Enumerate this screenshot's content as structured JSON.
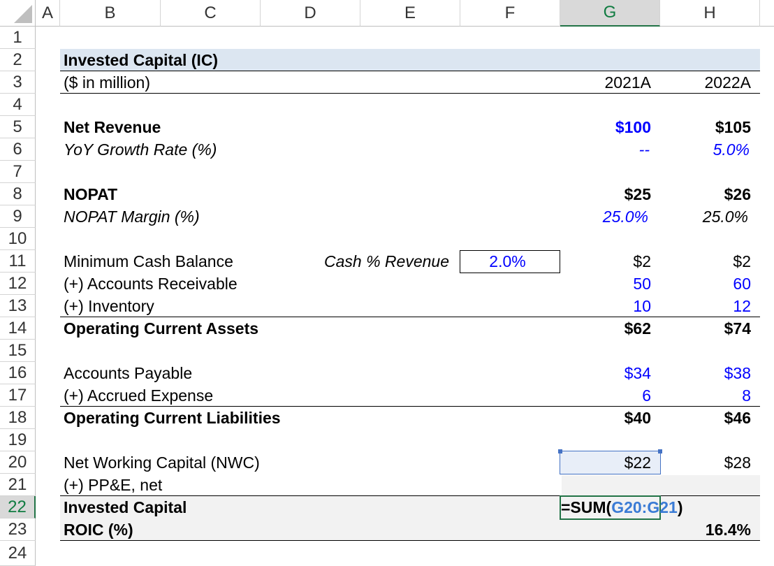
{
  "columns": [
    "A",
    "B",
    "C",
    "D",
    "E",
    "F",
    "G",
    "H"
  ],
  "rows": [
    "1",
    "2",
    "3",
    "4",
    "5",
    "6",
    "7",
    "8",
    "9",
    "10",
    "11",
    "12",
    "13",
    "14",
    "15",
    "16",
    "17",
    "18",
    "19",
    "20",
    "21",
    "22",
    "23",
    "24"
  ],
  "table": {
    "title": "Invested Capital (IC)",
    "units": "($ in million)",
    "years": [
      "2021A",
      "2022A"
    ],
    "net_revenue": {
      "label": "Net Revenue",
      "v2021": "$100",
      "v2022": "$105"
    },
    "yoy": {
      "label": "YoY Growth Rate (%)",
      "v2021": "--",
      "v2022": "5.0%"
    },
    "nopat": {
      "label": "NOPAT",
      "v2021": "$25",
      "v2022": "$26"
    },
    "nopat_margin": {
      "label": "NOPAT Margin (%)",
      "v2021": "25.0%",
      "v2022": "25.0%"
    },
    "min_cash": {
      "label": "Minimum Cash Balance",
      "assumption_label": "Cash % Revenue",
      "assumption_value": "2.0%",
      "v2021": "$2",
      "v2022": "$2"
    },
    "ar": {
      "label": "(+) Accounts Receivable",
      "v2021": "50",
      "v2022": "60"
    },
    "inventory": {
      "label": "(+) Inventory",
      "v2021": "10",
      "v2022": "12"
    },
    "oca": {
      "label": "Operating Current Assets",
      "v2021": "$62",
      "v2022": "$74"
    },
    "ap": {
      "label": "Accounts Payable",
      "v2021": "$34",
      "v2022": "$38"
    },
    "accrued": {
      "label": "(+) Accrued Expense",
      "v2021": "6",
      "v2022": "8"
    },
    "ocl": {
      "label": "Operating Current Liabilities",
      "v2021": "$40",
      "v2022": "$46"
    },
    "nwc": {
      "label": "Net Working Capital (NWC)",
      "v2021": "$22",
      "v2022": "$28"
    },
    "ppe": {
      "label": "(+) PP&E, net"
    },
    "ic": {
      "label": "Invested Capital",
      "formula_prefix": "=SUM(",
      "formula_ref": "G20:G21",
      "formula_suffix": ")"
    },
    "roic": {
      "label": "ROIC (%)",
      "v2022": "16.4%"
    }
  },
  "colors": {
    "header_band": "#dce6f1",
    "total_band": "#f2f2f2",
    "input_blue": "#0000ff",
    "selection": "#217346",
    "formula_ref": "#3a7bd5"
  }
}
